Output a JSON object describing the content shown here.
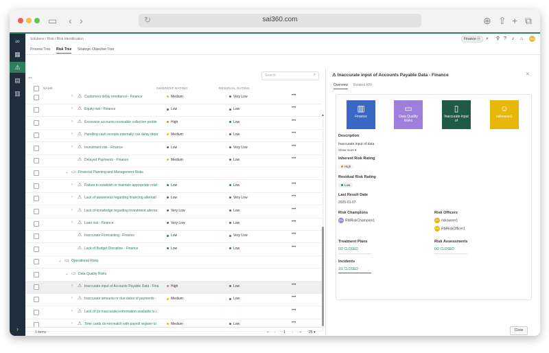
{
  "browser": {
    "url": "sai360.com"
  },
  "breadcrumb": "Solutions / Risk / Risk Identification",
  "header": {
    "filter_chip": "Finance",
    "avatar_initials": "RM"
  },
  "tabs": [
    "Process Tree",
    "Risk Tree",
    "Strategic Objective Tree"
  ],
  "active_tab": "Risk Tree",
  "grid": {
    "search_placeholder": "Search",
    "columns": {
      "name": "NAME",
      "inherent": "INHERENT RATING",
      "residual": "RESIDUAL RATING"
    },
    "rows": [
      {
        "type": "risk",
        "name": "Customers delay remittance - Finance",
        "inherent": "Medium",
        "residual": "Very Low"
      },
      {
        "type": "risk",
        "name": "Equity risk - Finance",
        "inherent": "Low",
        "residual": "Low"
      },
      {
        "type": "risk",
        "name": "Excessive accounts receivable collection proble",
        "inherent": "High",
        "residual": "Low"
      },
      {
        "type": "risk",
        "name": "Handling cash receipts internally can delay depo",
        "inherent": "Medium",
        "residual": "Low"
      },
      {
        "type": "risk",
        "name": "Investment risk - Finance",
        "inherent": "Low",
        "residual": "Very Low"
      },
      {
        "type": "risk-leaf",
        "name": "Delayed Payments - Finance",
        "inherent": "Medium",
        "residual": "Low"
      },
      {
        "type": "group",
        "name": "Financial Planning and Management Risks"
      },
      {
        "type": "risk",
        "name": "Failure to establish or maintain appropriate relat",
        "inherent": "Low",
        "residual": "Low"
      },
      {
        "type": "risk",
        "name": "Lack of awareness regarding financing alternati",
        "inherent": "Low",
        "residual": "Very Low"
      },
      {
        "type": "risk",
        "name": "Lack of knowledge regarding investment alterna",
        "inherent": "Very Low",
        "residual": "Low"
      },
      {
        "type": "risk",
        "name": "Loan risk - Finance",
        "inherent": "Very Low",
        "residual": "Low"
      },
      {
        "type": "risk-leaf",
        "name": "Inaccurate Forecasting - Finance",
        "inherent": "Low",
        "residual": "Very Low"
      },
      {
        "type": "risk-leaf",
        "name": "Lack of Budget Discipline - Finance",
        "inherent": "Low",
        "residual": "Low"
      },
      {
        "type": "group-top",
        "name": "Operational Risks"
      },
      {
        "type": "group",
        "name": "Data Quality Risks"
      },
      {
        "type": "risk",
        "name": "Inaccurate input of Accounts Payable Data - Fina",
        "inherent": "High",
        "residual": "Low",
        "selected": true
      },
      {
        "type": "risk",
        "name": "Inaccurate amounts or due dates of payments -",
        "inherent": "Medium",
        "residual": "Low"
      },
      {
        "type": "risk",
        "name": "Lack of (or inaccurate) information available to r",
        "inherent": "",
        "residual": ""
      },
      {
        "type": "risk",
        "name": "Time cards do not match with payroll register to",
        "inherent": "Medium",
        "residual": "Low"
      }
    ],
    "footer": {
      "count": "1 items",
      "page": "1",
      "page_size": "25"
    }
  },
  "detail": {
    "title": "Inaccurate input of Accounts Payable Data - Finance",
    "tabs": [
      "Overview",
      "Related KRI"
    ],
    "tiles": [
      {
        "label": "Finance",
        "color": "#3a66c4"
      },
      {
        "label": "Data Quality Risks",
        "color": "#a07fdc"
      },
      {
        "label": "Inaccurate input of",
        "color": "#1e5a45"
      },
      {
        "label": "riskowner1",
        "color": "#e5b80b"
      }
    ],
    "description_label": "Description",
    "description": "Inaccurate input of data",
    "show_more": "Show more",
    "inherent_label": "Inherent Risk Rating",
    "inherent_value": "High",
    "residual_label": "Residual Risk Rating",
    "residual_value": "Low",
    "last_result_label": "Last Result Date",
    "last_result_value": "2025-01-07",
    "champions_label": "Risk Champions",
    "champion": {
      "initials": "RM",
      "name": "RMRiskChampion1"
    },
    "officers_label": "Risk Officers",
    "officers": [
      {
        "initials": "RI",
        "name": "riskowner1"
      },
      {
        "initials": "RM",
        "name": "RMRiskOfficer1"
      }
    ],
    "treatment_label": "Treatment Plans",
    "treatment_value": "0/2 CLOSED",
    "assessments_label": "Risk Assessments",
    "assessments_value": "0/2 CLOSED",
    "incidents_label": "Incidents",
    "incidents_value": "1/1 CLOSED",
    "close_button": "Close"
  },
  "colors": {
    "accent": "#2e7d5b",
    "high": "#e8813a",
    "medium": "#e5b80b",
    "low": "#2e7d5b",
    "verylow": "#2e7d5b"
  }
}
